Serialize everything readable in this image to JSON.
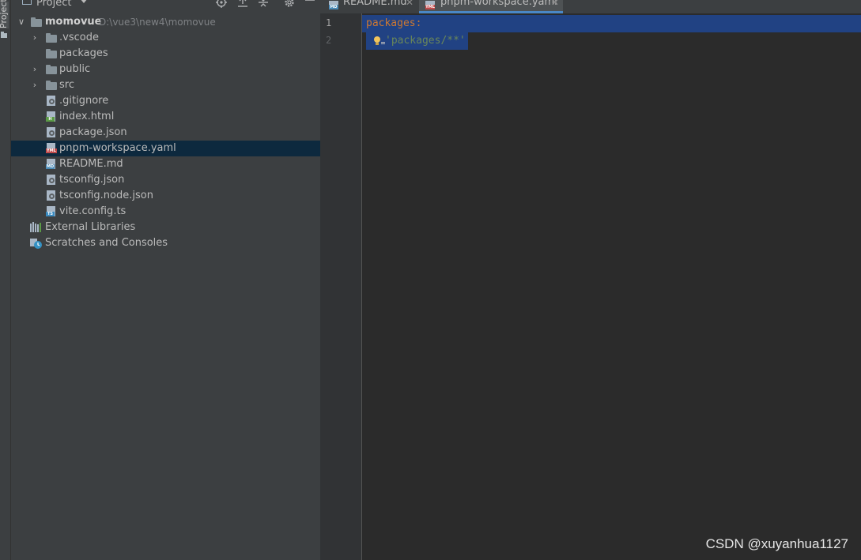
{
  "tool_strip": {
    "label": "Project"
  },
  "panel": {
    "title": "Project",
    "buttons": [
      "locate-icon",
      "collapse-all-icon",
      "expand-icon",
      "gear-icon",
      "hide-icon"
    ]
  },
  "tree": {
    "root": {
      "name": "momovue",
      "path": "D:\\vue3\\new4\\momovue"
    },
    "items": [
      {
        "label": ".vscode",
        "kind": "folder",
        "expandable": true
      },
      {
        "label": "packages",
        "kind": "folder",
        "expandable": false
      },
      {
        "label": "public",
        "kind": "folder",
        "expandable": true
      },
      {
        "label": "src",
        "kind": "folder",
        "expandable": true
      },
      {
        "label": ".gitignore",
        "kind": "file",
        "tag": ""
      },
      {
        "label": "index.html",
        "kind": "file",
        "tag": "H"
      },
      {
        "label": "package.json",
        "kind": "file",
        "tag": ""
      },
      {
        "label": "pnpm-workspace.yaml",
        "kind": "file",
        "tag": "YML",
        "selected": true
      },
      {
        "label": "README.md",
        "kind": "file",
        "tag": "MD"
      },
      {
        "label": "tsconfig.json",
        "kind": "file",
        "tag": ""
      },
      {
        "label": "tsconfig.node.json",
        "kind": "file",
        "tag": ""
      },
      {
        "label": "vite.config.ts",
        "kind": "file",
        "tag": "TS"
      }
    ],
    "external_libraries": "External Libraries",
    "scratches": "Scratches and Consoles"
  },
  "tabs": [
    {
      "label": "README.md",
      "tag": "MD",
      "active": false
    },
    {
      "label": "pnpm-workspace.yaml",
      "tag": "YML",
      "active": true
    }
  ],
  "editor": {
    "line_numbers": [
      "1",
      "2"
    ],
    "line1": {
      "key": "packages",
      "punct": ":"
    },
    "line2": {
      "dash": "- ",
      "value": "'packages/**'"
    }
  },
  "watermark": "CSDN @xuyanhua1127",
  "colors": {
    "selection": "#214283",
    "tree_selected": "#0d293e",
    "yaml_key": "#cc7832",
    "yaml_string": "#6a8759",
    "tag_yml": "#c14a4a",
    "tag_md": "#4a8ab6",
    "tag_html": "#5b9a46",
    "tag_ts": "#3b8bc0"
  }
}
